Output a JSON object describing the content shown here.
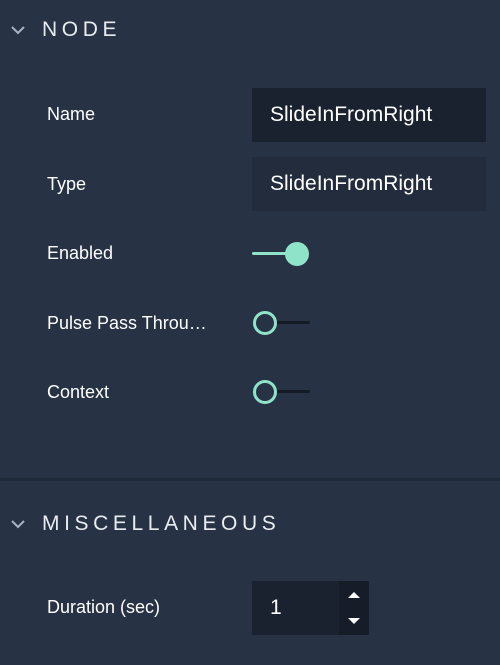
{
  "sections": {
    "node": {
      "title": "NODE",
      "fields": {
        "name": {
          "label": "Name",
          "value": "SlideInFromRight"
        },
        "type": {
          "label": "Type",
          "value": "SlideInFromRight"
        },
        "enabled": {
          "label": "Enabled",
          "checked": true
        },
        "pulse_pass_through": {
          "label": "Pulse Pass Throu…",
          "checked": false
        },
        "context": {
          "label": "Context",
          "checked": false
        }
      }
    },
    "miscellaneous": {
      "title": "MISCELLANEOUS",
      "fields": {
        "duration": {
          "label": "Duration (sec)",
          "value": "1"
        }
      }
    }
  },
  "icons": {
    "section_collapse": "chevron-down-icon",
    "increment": "caret-up-icon",
    "decrement": "caret-down-icon"
  },
  "colors": {
    "background": "#273244",
    "field_background": "#1a2230",
    "accent": "#8fe3c8",
    "divider": "#1f2938"
  }
}
